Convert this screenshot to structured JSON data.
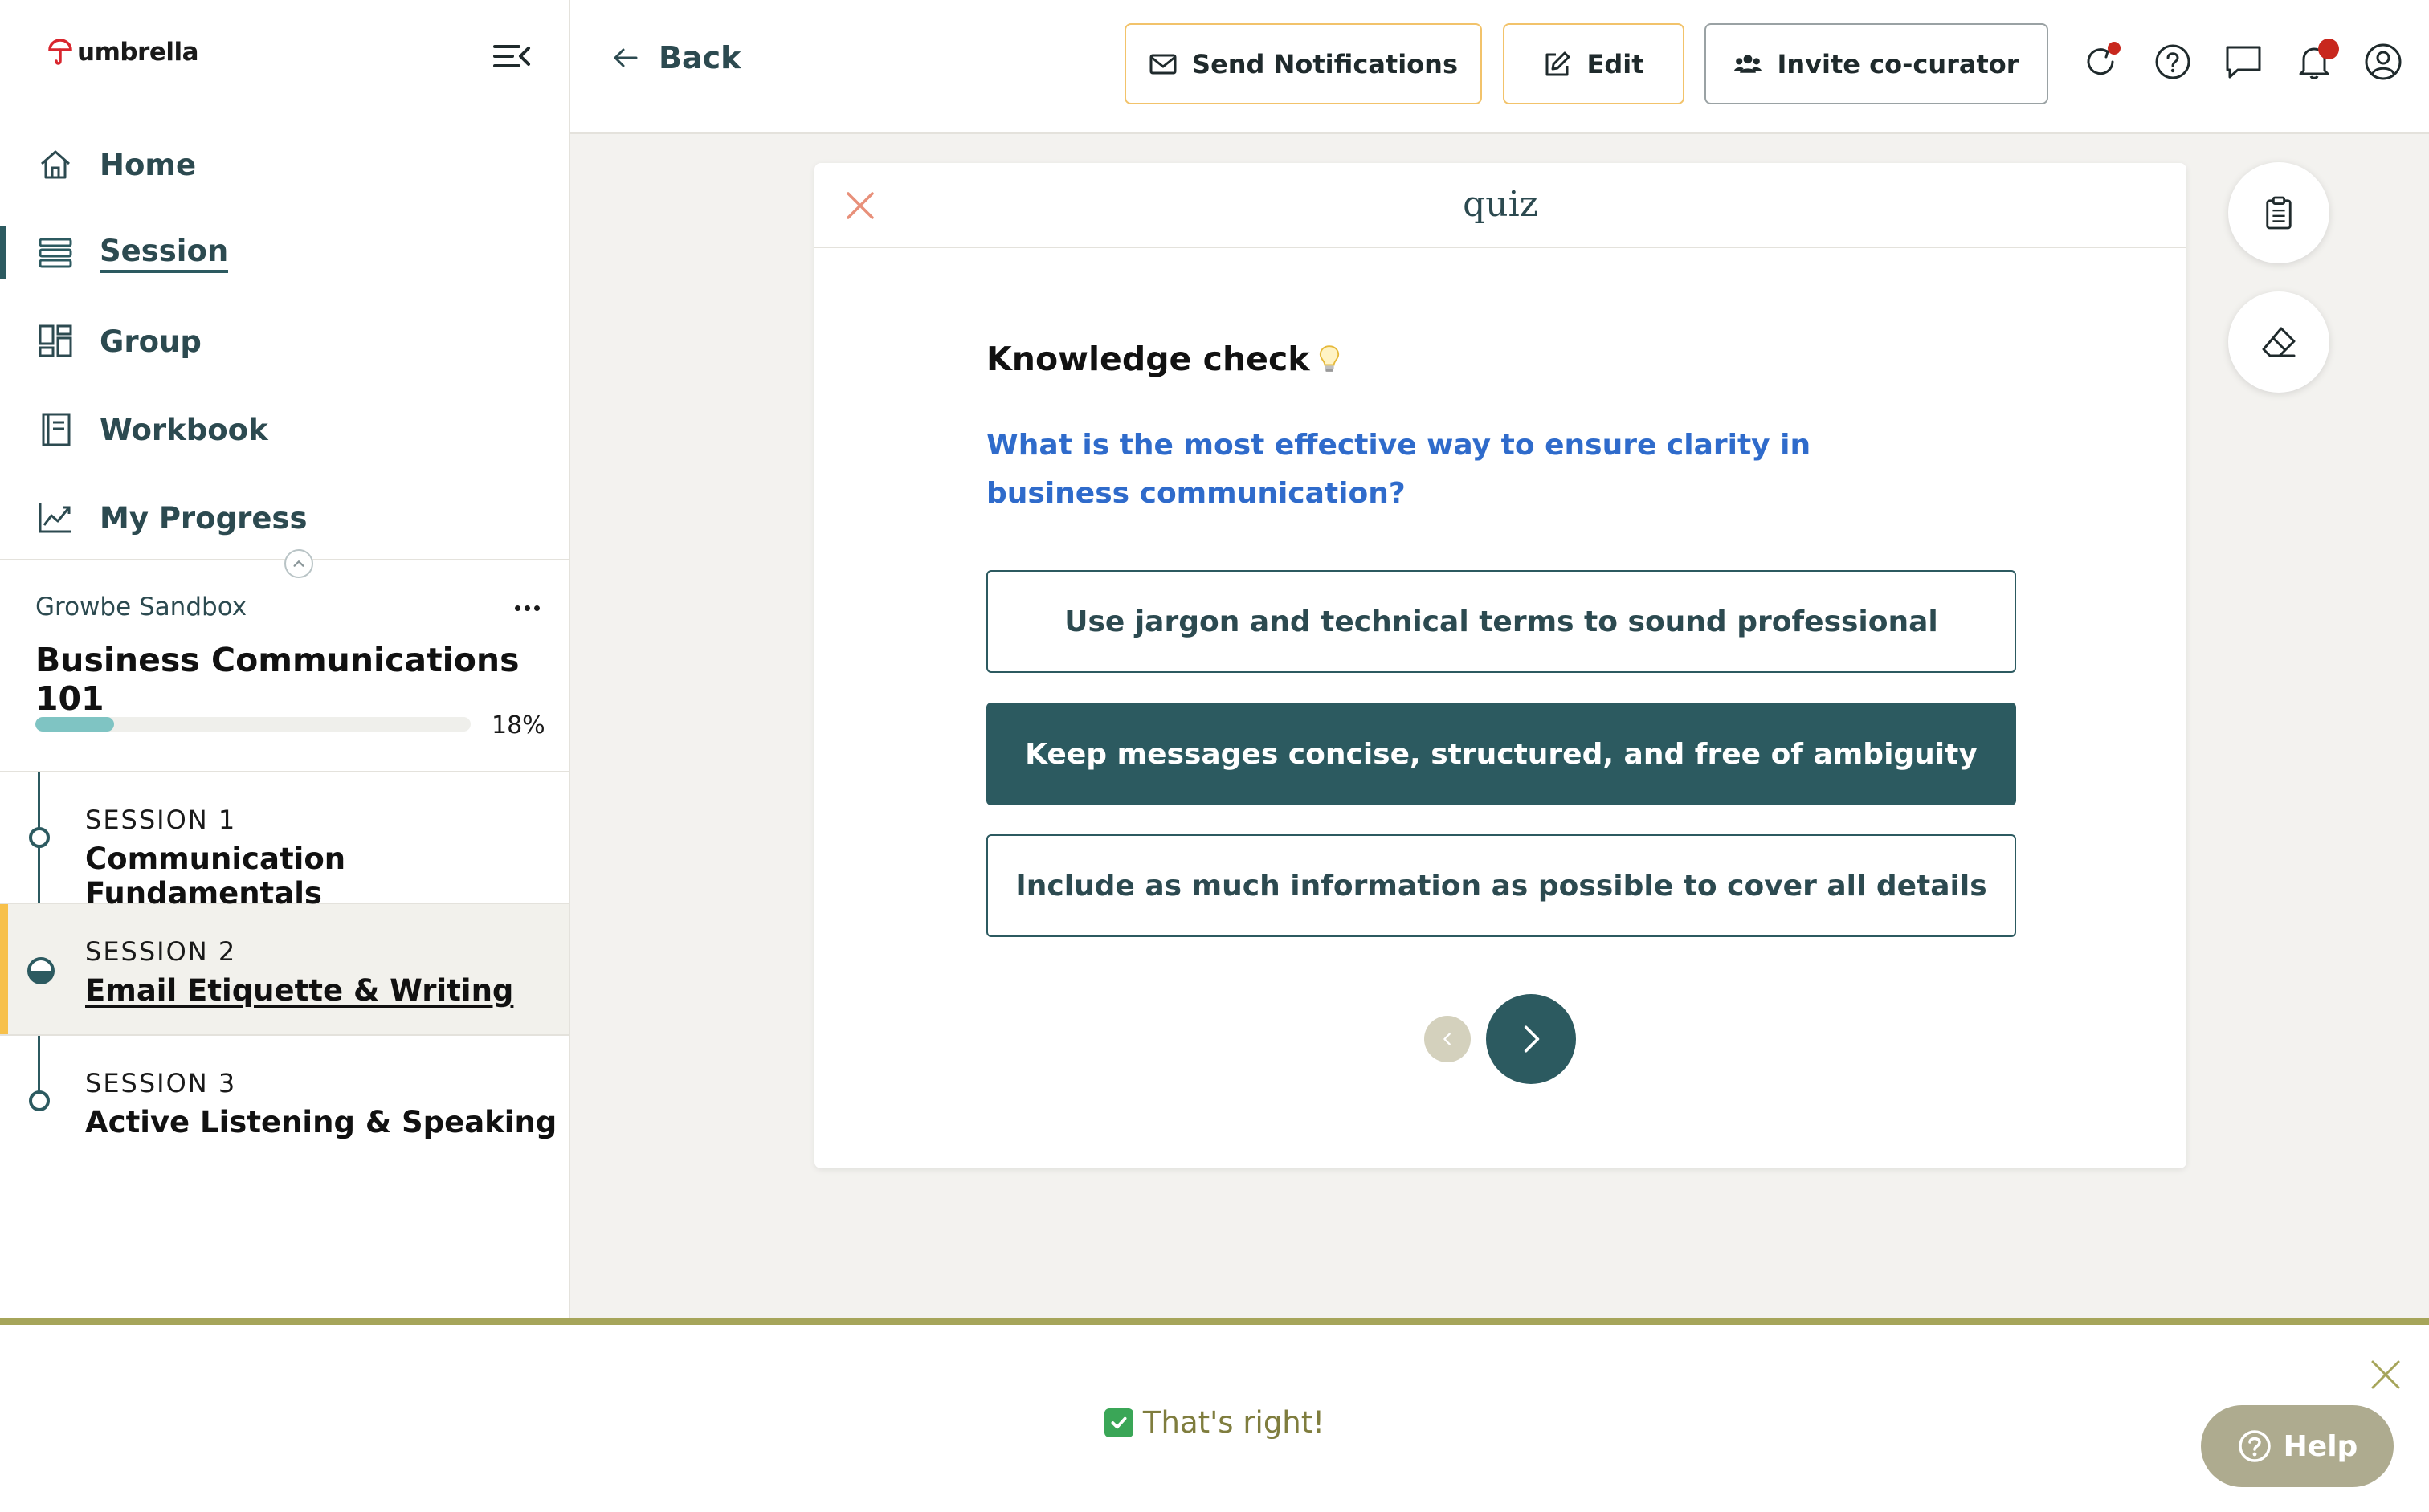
{
  "app": {
    "logo_text": "umbrella"
  },
  "sidebar": {
    "nav": [
      {
        "label": "Home",
        "icon": "home-icon",
        "active": false
      },
      {
        "label": "Session",
        "icon": "session-list-icon",
        "active": true
      },
      {
        "label": "Group",
        "icon": "group-icon",
        "active": false
      },
      {
        "label": "Workbook",
        "icon": "workbook-icon",
        "active": false
      },
      {
        "label": "My Progress",
        "icon": "progress-chart-icon",
        "active": false
      }
    ],
    "org_name": "Growbe Sandbox",
    "course_title": "Business Communications 101",
    "progress": {
      "percent": 18,
      "label": "18%"
    },
    "sessions": [
      {
        "number": "SESSION 1",
        "title": "Communication Fundamentals",
        "current": false
      },
      {
        "number": "SESSION 2",
        "title": "Email Etiquette & Writing",
        "current": true
      },
      {
        "number": "SESSION 3",
        "title": "Active Listening & Speaking",
        "current": false
      }
    ]
  },
  "topbar": {
    "back_label": "Back",
    "send_notifications_label": "Send Notifications",
    "edit_label": "Edit",
    "invite_label": "Invite co-curator",
    "icons": [
      "refresh-icon",
      "help-circle-icon",
      "chat-icon",
      "bell-icon",
      "user-icon"
    ]
  },
  "quiz": {
    "title": "quiz",
    "heading": "Knowledge check",
    "heading_icon": "lightbulb-icon",
    "question": "What is the most effective way to ensure clarity in business communication?",
    "options": [
      {
        "label": "Use jargon and technical terms to sound professional",
        "selected": false
      },
      {
        "label": "Keep messages concise, structured, and free of ambiguity",
        "selected": true
      },
      {
        "label": "Include as much information as possible to cover all details",
        "selected": false
      }
    ]
  },
  "side_tools": [
    "clipboard-icon",
    "eraser-icon"
  ],
  "feedback": {
    "message": "That's right!",
    "icon": "check-box-icon"
  },
  "help": {
    "label": "Help"
  },
  "colors": {
    "primary": "#2c5a60",
    "accent_yellow": "#f7c04a",
    "question_blue": "#2f6bcb",
    "progress": "#7fc4c3",
    "feedback_border": "#a6a55a",
    "feedback_text": "#7f7d3e",
    "badge_red": "#c8281e"
  }
}
